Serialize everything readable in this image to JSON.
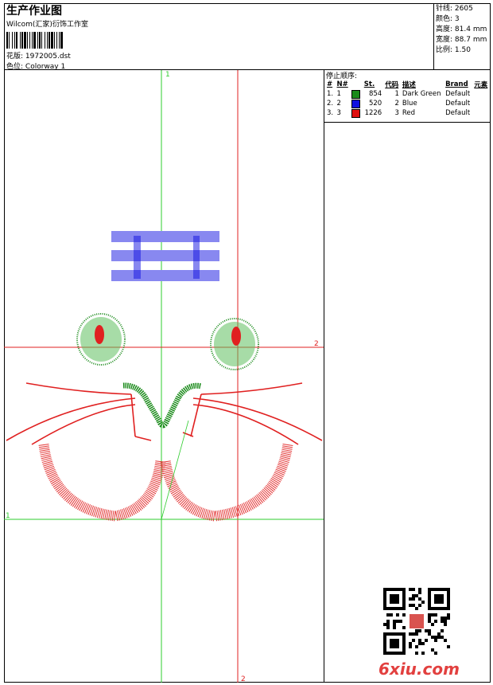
{
  "header": {
    "title": "生产作业图",
    "studio": "Wilcom(汇家)衍饰工作室",
    "design_label": "花版:",
    "design_value": "1972005.dst",
    "colorway_label": "色位:",
    "colorway_value": "Colorway 1"
  },
  "stats": [
    {
      "label": "针线:",
      "value": "2605"
    },
    {
      "label": "颜色:",
      "value": "3"
    },
    {
      "label": "高度:",
      "value": "81.4 mm"
    },
    {
      "label": "宽度:",
      "value": "88.7 mm"
    },
    {
      "label": "比例:",
      "value": "1.50"
    }
  ],
  "stop_sequence": {
    "title": "停止顺序:",
    "columns": [
      "#",
      "N#",
      "St.",
      "代码",
      "描述",
      "Brand",
      "元素"
    ],
    "rows": [
      {
        "num": "1.",
        "needle": "1",
        "color": "#1a8a1a",
        "stitches": "854",
        "code": "1",
        "desc": "Dark Green",
        "brand": "Default"
      },
      {
        "num": "2.",
        "needle": "2",
        "color": "#1010e0",
        "stitches": "520",
        "code": "2",
        "desc": "Blue",
        "brand": "Default"
      },
      {
        "num": "3.",
        "needle": "3",
        "color": "#e01010",
        "stitches": "1226",
        "code": "3",
        "desc": "Red",
        "brand": "Default"
      }
    ]
  },
  "guides": {
    "green_label_top": "1",
    "green_label_left": "1",
    "red_label_right": "2",
    "red_label_bottom": "2"
  },
  "watermark": "6xiu.com"
}
